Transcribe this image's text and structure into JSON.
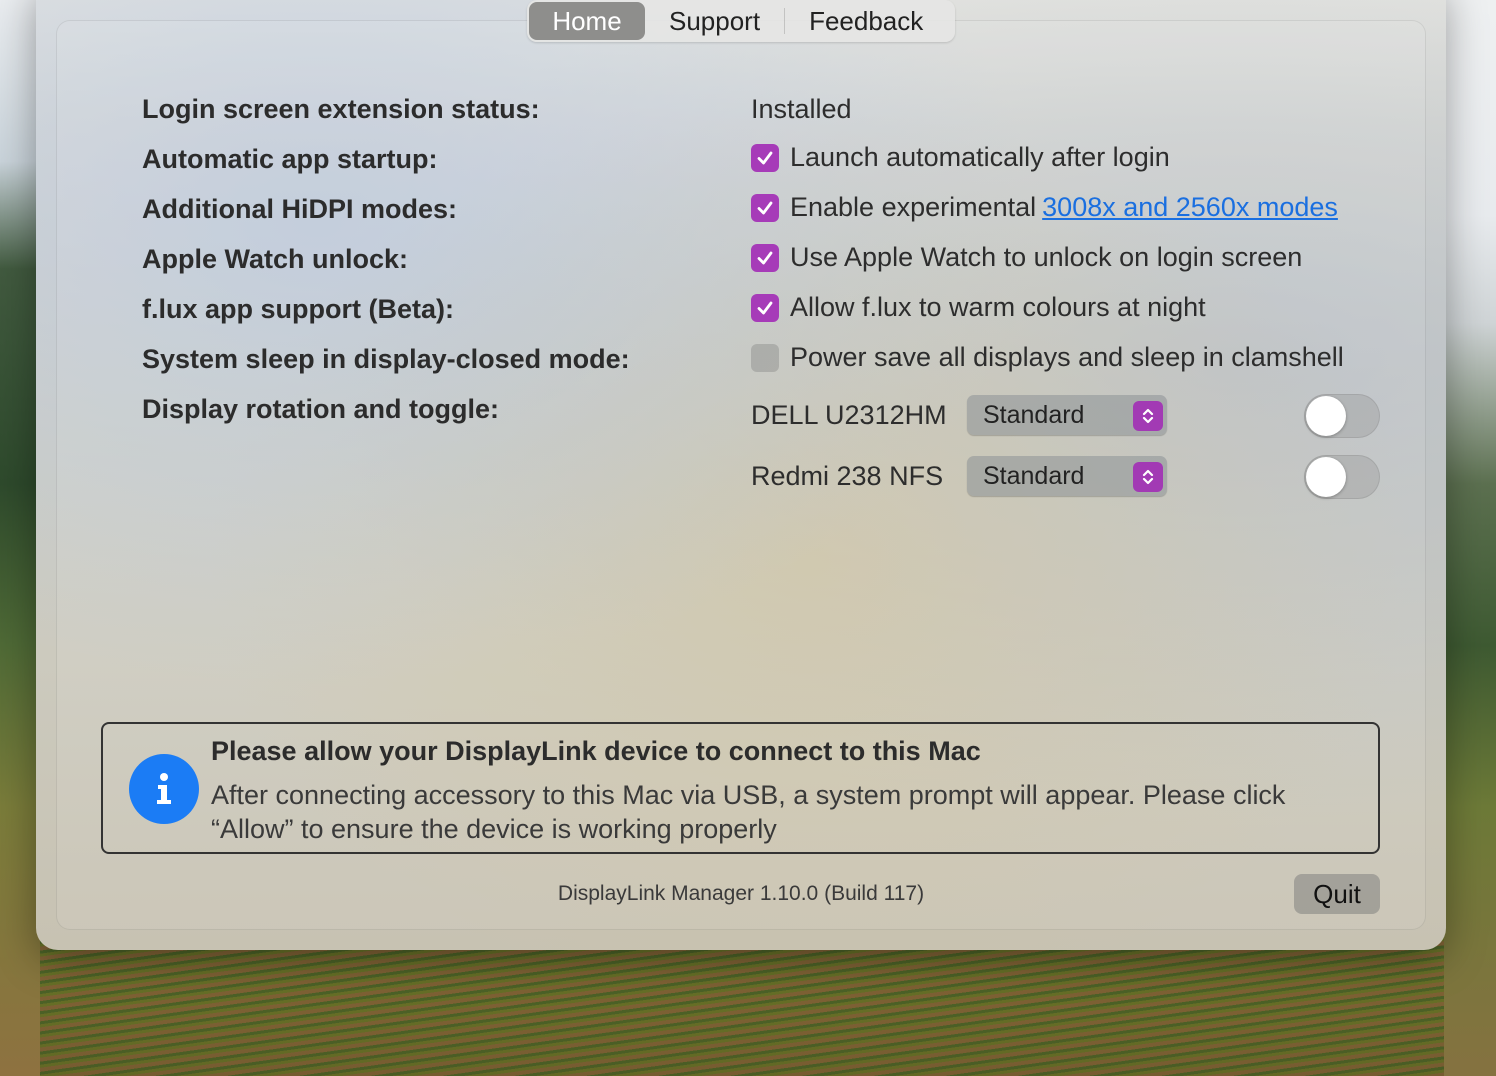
{
  "tabs": [
    {
      "label": "Home"
    },
    {
      "label": "Support"
    },
    {
      "label": "Feedback"
    }
  ],
  "settings": {
    "login_status": {
      "label": "Login screen extension status:",
      "value": "Installed"
    },
    "auto_startup": {
      "label": "Automatic app startup:",
      "text": "Launch automatically after login",
      "checked": true
    },
    "hidpi": {
      "label": "Additional HiDPI modes:",
      "text": "Enable experimental",
      "link": "3008x and 2560x modes",
      "checked": true
    },
    "watch_unlock": {
      "label": "Apple Watch unlock:",
      "text": "Use Apple Watch to unlock on login screen",
      "checked": true
    },
    "flux": {
      "label": "f.lux app support (Beta):",
      "text": "Allow f.lux to warm colours at night",
      "checked": true
    },
    "sleep": {
      "label": "System sleep in display-closed mode:",
      "text": "Power save all displays and sleep in clamshell",
      "checked": false
    },
    "rotation": {
      "label": "Display rotation and toggle:"
    }
  },
  "displays": [
    {
      "name": "DELL U2312HM",
      "rotation": "Standard",
      "enabled": false
    },
    {
      "name": "Redmi 238 NFS",
      "rotation": "Standard",
      "enabled": false
    }
  ],
  "notice": {
    "title": "Please allow your DisplayLink device to connect to this Mac",
    "body": "After connecting accessory to this Mac via USB, a system prompt will appear. Please click “Allow” to ensure the device is working properly"
  },
  "footer": {
    "version": "DisplayLink Manager 1.10.0 (Build 117)",
    "quit_label": "Quit"
  },
  "colors": {
    "accent": "#a63bb8",
    "link": "#1a6fe0",
    "info": "#1b7cf5"
  }
}
